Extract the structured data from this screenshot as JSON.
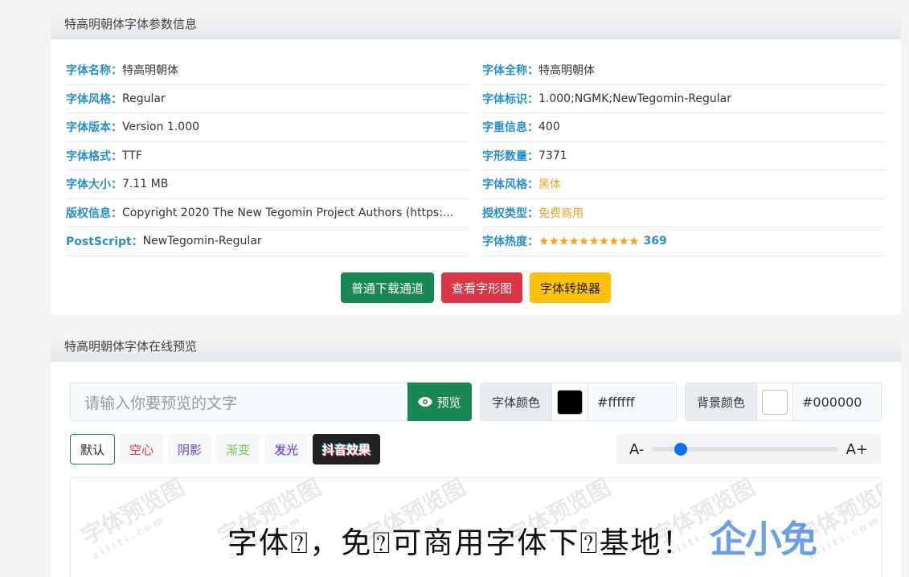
{
  "info_card": {
    "title": "特高明朝体字体参数信息",
    "left": [
      {
        "k": "字体名称：",
        "v": "特高明朝体"
      },
      {
        "k": "字体风格：",
        "v": "Regular"
      },
      {
        "k": "字体版本：",
        "v": "Version 1.000"
      },
      {
        "k": "字体格式：",
        "v": "TTF"
      },
      {
        "k": "字体大小：",
        "v": "7.11 MB"
      },
      {
        "k": "版权信息：",
        "v": "Copyright 2020 The New Tegomin Project Authors (https:..."
      },
      {
        "k": "PostScript：",
        "v": "NewTegomin-Regular"
      }
    ],
    "right": [
      {
        "k": "字体全称：",
        "v": "特高明朝体"
      },
      {
        "k": "字体标识：",
        "v": "1.000;NGMK;NewTegomin-Regular"
      },
      {
        "k": "字重信息：",
        "v": "400"
      },
      {
        "k": "字形数量：",
        "v": "7371"
      },
      {
        "k": "字体风格：",
        "v": "黑体"
      },
      {
        "k": "授权类型：",
        "v": "免费商用"
      }
    ],
    "heat_label": "字体热度：",
    "heat_stars": "★★★★★★★★★★",
    "heat_rating_stars": 10,
    "heat_count": "369",
    "buttons": {
      "download": "普通下载通道",
      "glyphs": "查看字形图",
      "converter": "字体转换器"
    }
  },
  "preview_card": {
    "title": "特高明朝体字体在线预览",
    "input_placeholder": "请输入你要预览的文字",
    "preview_button": "预览",
    "font_color_label": "字体颜色",
    "font_color_value": "#ffffff",
    "font_color_swatch": "#000000",
    "bg_color_label": "背景颜色",
    "bg_color_value": "#000000",
    "bg_color_swatch": "#ffffff",
    "effects": [
      "默认",
      "空心",
      "阴影",
      "渐变",
      "发光",
      "抖音效果"
    ],
    "size_minus": "A-",
    "size_plus": "A+",
    "sample_text": "字体⍰，免⍰可商用字体下⍰基地！",
    "logo_text": "企小免"
  }
}
